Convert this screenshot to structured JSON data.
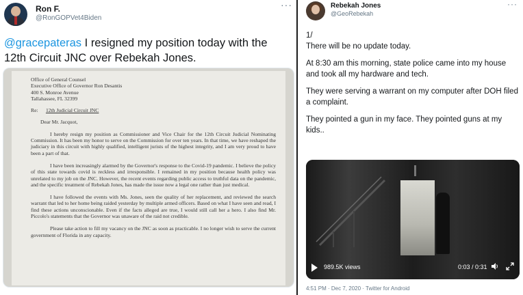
{
  "left_tweet": {
    "author_name": "Ron F.",
    "author_handle": "@RonGOPVet4Biden",
    "menu_icon": "more-icon",
    "text_mention": "@gracepateras",
    "text_rest": " I resigned my position today with the 12th Circuit JNC over Rebekah Jones.",
    "letter": {
      "address_lines": [
        "Office of General Counsel",
        "Executive Office of Governor Ron Desantis",
        "400 S. Monroe Avenue",
        "Tallahassee, FL 32399"
      ],
      "re_label": "Re:",
      "re_subject": "12th Judicial Circuit JNC",
      "salutation": "Dear Mr. Jacquot,",
      "paragraphs": [
        "I hereby resign my position as Commissioner and Vice Chair for the 12th Circuit Judicial Nominating Commission. It has been my honor to serve on the Commission for over ten years. In that time, we have reshaped the judiciary in this circuit with highly qualified, intelligent jurists of the highest integrity, and I am very proud to have been a part of that.",
        "I have been increasingly alarmed by the Governor's response to the Covid-19 pandemic. I believe the policy of this state towards covid is reckless and irresponsible. I remained in my position because health policy was unrelated to my job on the JNC. However, the recent events regarding public access to truthful data on the pandemic, and the specific treatment of Rebekah Jones, has made the issue now a legal one rather than just medical.",
        "I have followed the events with Ms. Jones, seen the quality of her replacement, and reviewed the search warrant that led to her home being raided yesterday by multiple armed officers. Based on what I have seen and read, I find these actions unconscionable. Even if the facts alleged are true, I would still call her a hero. I also find Mr. Piccolo's statements that the Governor was unaware of the raid not credible.",
        "Please take action to fill my vacancy on the JNC as soon as practicable. I no longer wish to serve the current government of Florida in any capacity."
      ]
    }
  },
  "right_tweet": {
    "author_name": "Rebekah Jones",
    "author_handle": "@GeoRebekah",
    "menu_icon": "more-icon",
    "paragraphs": [
      "1/",
      "There will be no update today.",
      "At 8:30 am this morning, state police came into my house and took all my hardware and tech.",
      "They were serving a warrant on my computer after DOH filed a complaint.",
      "They pointed a gun in my face.  They pointed guns at my kids.."
    ],
    "video": {
      "views": "989.5K views",
      "time": "0:03 / 0:31",
      "play_icon": "play-icon",
      "volume_icon": "volume-icon",
      "fullscreen_icon": "fullscreen-icon"
    },
    "meta": "4:51 PM · Dec 7, 2020 · Twitter for Android"
  }
}
